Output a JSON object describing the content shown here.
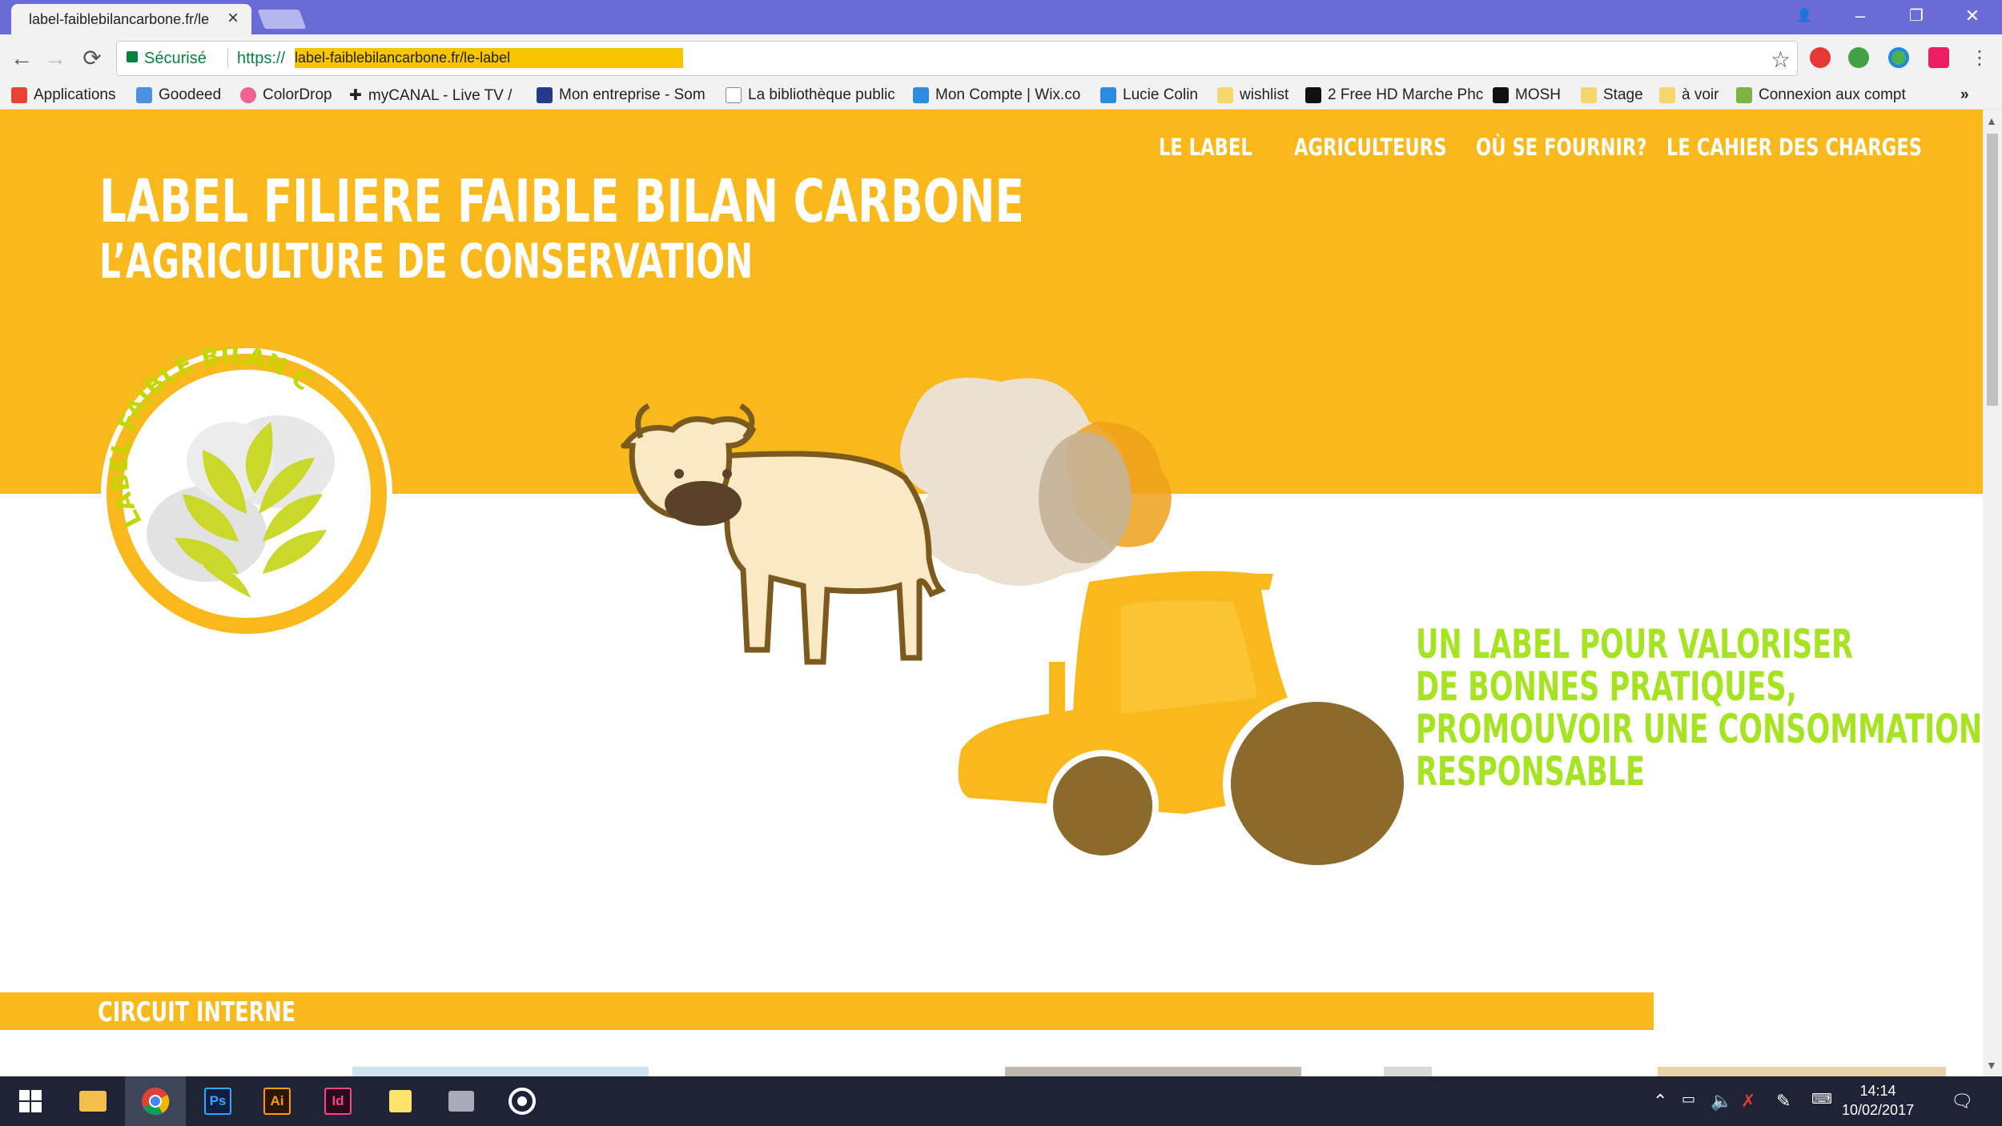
{
  "browser": {
    "tab_title": "label-faiblebilancarbone.fr/le",
    "security_label": "Sécurisé",
    "url_protocol": "https://",
    "url_host": "label-faiblebilancarbone.fr/le-label"
  },
  "bookmarks": [
    {
      "label": "Applications",
      "icon": "apps-grid-icon",
      "color": "#e94235"
    },
    {
      "label": "Goodeed",
      "icon": "goodeed-icon",
      "color": "#4a90e2"
    },
    {
      "label": "ColorDrop",
      "icon": "colordrop-icon",
      "color": "#f06292"
    },
    {
      "label": "myCANAL - Live TV /",
      "icon": "plus-icon",
      "color": "#111111"
    },
    {
      "label": "Mon entreprise - Som",
      "icon": "company-icon",
      "color": "#243a8a"
    },
    {
      "label": "La bibliothèque public",
      "icon": "page-icon",
      "color": "#ffffff"
    },
    {
      "label": "Mon Compte | Wix.co",
      "icon": "wix-icon",
      "color": "#2b8ce0"
    },
    {
      "label": "Lucie Colin",
      "icon": "wix-icon",
      "color": "#2b8ce0"
    },
    {
      "label": "wishlist",
      "icon": "folder-icon",
      "color": "#f5d76e"
    },
    {
      "label": "2 Free HD Marche Phc",
      "icon": "camera-icon",
      "color": "#111111"
    },
    {
      "label": "MOSH",
      "icon": "mosh-icon",
      "color": "#111111"
    },
    {
      "label": "Stage",
      "icon": "folder-icon",
      "color": "#f5d76e"
    },
    {
      "label": "à voir",
      "icon": "folder-icon",
      "color": "#f5d76e"
    },
    {
      "label": "Connexion aux compt",
      "icon": "login-icon",
      "color": "#7cb342"
    }
  ],
  "site": {
    "nav": [
      "LE LABEL",
      "AGRICULTEURS",
      "OÙ SE FOURNIR?",
      "LE CAHIER DES CHARGES"
    ],
    "title": "LABEL FILIERE FAIBLE BILAN CARBONE",
    "subtitle": "L’AGRICULTURE DE CONSERVATION",
    "logo_text": "LABEL FAIBLE BILAN CARBONE",
    "tagline": [
      "UN LABEL POUR VALORISER",
      "DE BONNES PRATIQUES,",
      "PROMOUVOIR UNE CONSOMMATION",
      "RESPONSABLE"
    ],
    "section_title": "CIRCUIT INTERNE"
  },
  "taskbar": {
    "time": "14:14",
    "date": "10/02/2017",
    "apps": [
      {
        "name": "start-button",
        "label": ""
      },
      {
        "name": "file-explorer",
        "label": ""
      },
      {
        "name": "chrome",
        "label": ""
      },
      {
        "name": "photoshop",
        "label": "Ps"
      },
      {
        "name": "illustrator",
        "label": "Ai"
      },
      {
        "name": "indesign",
        "label": "Id"
      },
      {
        "name": "sticky-notes",
        "label": ""
      },
      {
        "name": "media-app",
        "label": ""
      },
      {
        "name": "groove-app",
        "label": ""
      }
    ]
  },
  "colors": {
    "brand_yellow": "#f9b91d",
    "tagline_green": "#a6e322",
    "chrome_frame": "#6b6bd6",
    "taskbar": "#1e2436"
  }
}
